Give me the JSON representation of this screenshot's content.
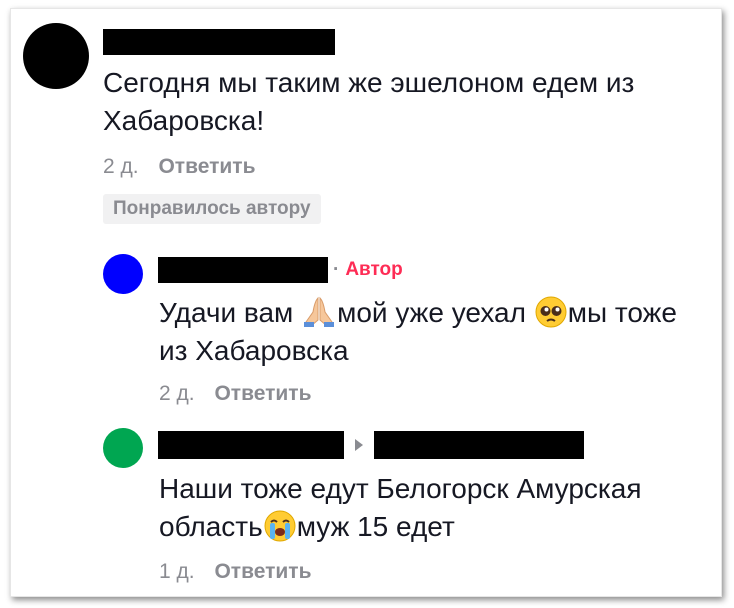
{
  "comments": [
    {
      "avatar_color": "#000000",
      "text": "Сегодня мы таким же эшелоном едем из Хабаровска!",
      "time": "2 д.",
      "reply_label": "Ответить",
      "liked_badge": "Понравилось автору"
    },
    {
      "avatar_color": "#0000ff",
      "author_tag": "Автор",
      "text_a": "Удачи вам ",
      "emoji_a": "folded-hands",
      "text_b": "мой уже уехал ",
      "emoji_b": "pleading-face",
      "text_c": "мы тоже",
      "text_line2": "из Хабаровска",
      "time": "2 д.",
      "reply_label": "Ответить"
    },
    {
      "avatar_color": "#00a651",
      "text_line1": "Наши тоже едут Белогорск Амурская",
      "text_a": "область",
      "emoji_a": "loudly-crying-face",
      "text_b": "муж 15 едет",
      "time": "1 д.",
      "reply_label": "Ответить"
    }
  ]
}
